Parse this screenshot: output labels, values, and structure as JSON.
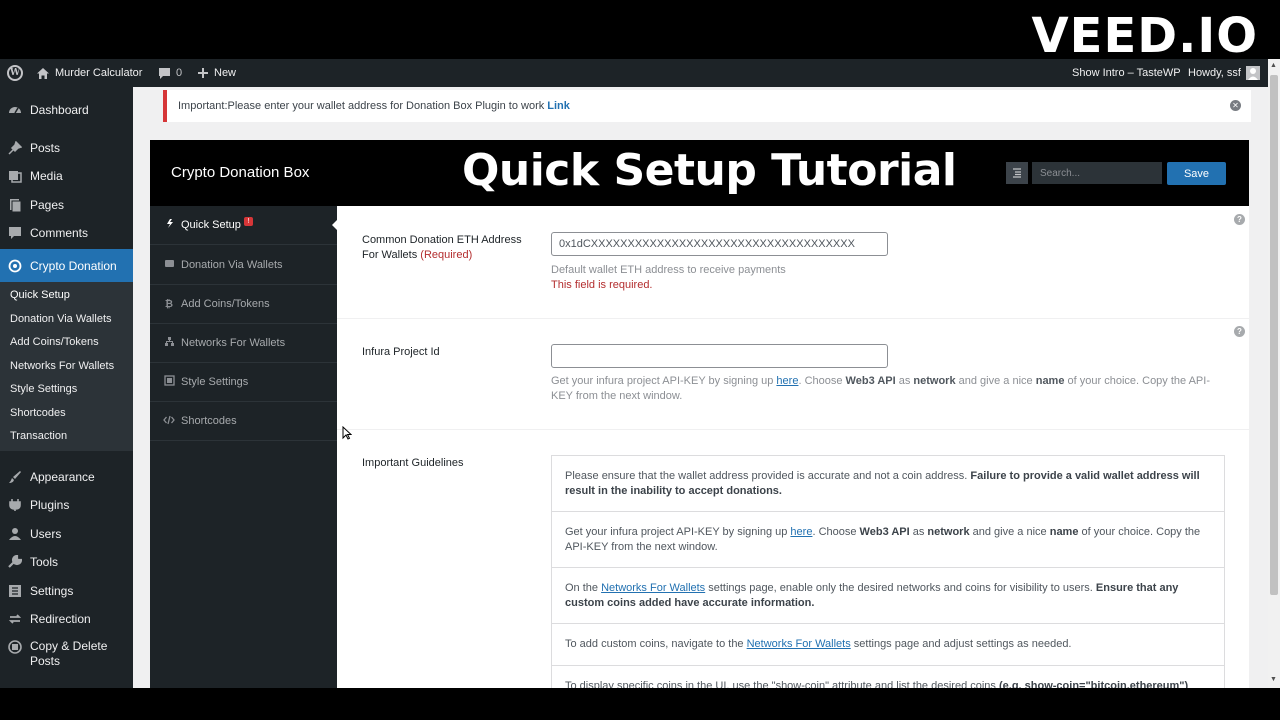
{
  "watermark": "VEED.IO",
  "adminbar": {
    "site_name": "Murder Calculator",
    "comments_count": "0",
    "new_label": "New",
    "show_intro": "Show Intro – TasteWP",
    "howdy": "Howdy, ssf"
  },
  "sidebar": {
    "items": [
      {
        "label": "Dashboard",
        "icon": "dashboard-icon"
      },
      {
        "label": "Posts",
        "icon": "pin-icon"
      },
      {
        "label": "Media",
        "icon": "media-icon"
      },
      {
        "label": "Pages",
        "icon": "pages-icon"
      },
      {
        "label": "Comments",
        "icon": "comment-icon"
      },
      {
        "label": "Crypto Donation",
        "icon": "crypto-icon"
      },
      {
        "label": "Appearance",
        "icon": "brush-icon"
      },
      {
        "label": "Plugins",
        "icon": "plugin-icon"
      },
      {
        "label": "Users",
        "icon": "users-icon"
      },
      {
        "label": "Tools",
        "icon": "wrench-icon"
      },
      {
        "label": "Settings",
        "icon": "settings-icon"
      },
      {
        "label": "Redirection",
        "icon": "redirect-icon"
      },
      {
        "label": "Copy & Delete Posts",
        "icon": "copy-icon"
      }
    ],
    "submenu": [
      "Quick Setup",
      "Donation Via Wallets",
      "Add Coins/Tokens",
      "Networks For Wallets",
      "Style Settings",
      "Shortcodes",
      "Transaction"
    ]
  },
  "notice": {
    "text": "Important:Please enter your wallet address for Donation Box Plugin to work",
    "link": "Link"
  },
  "plugin": {
    "title": "Crypto Donation Box",
    "overlay_title": "Quick Setup Tutorial",
    "search_placeholder": "Search...",
    "save_label": "Save",
    "badge": "!",
    "nav": [
      {
        "label": "Quick Setup",
        "icon": "setup-icon"
      },
      {
        "label": "Donation Via Wallets",
        "icon": "wallet-icon"
      },
      {
        "label": "Add Coins/Tokens",
        "icon": "bitcoin-icon"
      },
      {
        "label": "Networks For Wallets",
        "icon": "network-icon"
      },
      {
        "label": "Style Settings",
        "icon": "style-icon"
      },
      {
        "label": "Shortcodes",
        "icon": "code-icon"
      }
    ]
  },
  "fields": {
    "eth_label": "Common Donation ETH Address For Wallets",
    "eth_required": "(Required)",
    "eth_value": "0x1dCXXXXXXXXXXXXXXXXXXXXXXXXXXXXXXXXXXXX",
    "eth_desc": "Default wallet ETH address to receive payments",
    "eth_error": "This field is required.",
    "infura_label": "Infura Project Id",
    "infura_value": "",
    "infura_desc": {
      "p1": "Get your infura project API-KEY by signing up ",
      "link": "here",
      "p2": ". Choose ",
      "b1": "Web3 API",
      "p3": " as ",
      "b2": "network",
      "p4": " and give a nice ",
      "b3": "name",
      "p5": " of your choice. Copy the API-KEY from the next window."
    },
    "guidelines_label": "Important Guidelines"
  },
  "guidelines": {
    "g1": {
      "p1": "Please ensure that the wallet address provided is accurate and not a coin address. ",
      "b1": "Failure to provide a valid wallet address will result in the inability to accept donations."
    },
    "g2": {
      "p1": "Get your infura project API-KEY by signing up ",
      "link": "here",
      "p2": ". Choose ",
      "b1": "Web3 API",
      "p3": " as ",
      "b2": "network",
      "p4": " and give a nice ",
      "b3": "name",
      "p5": " of your choice. Copy the API-KEY from the next window."
    },
    "g3": {
      "p1": "On the ",
      "link": "Networks For Wallets",
      "p2": " settings page, enable only the desired networks and coins for visibility to users. ",
      "b1": "Ensure that any custom coins added have accurate information."
    },
    "g4": {
      "p1": "To add custom coins, navigate to the ",
      "link": "Networks For Wallets",
      "p2": " settings page and adjust settings as needed."
    },
    "g5": {
      "p1": "To display specific coins in the UI, use the \"show-coin\" attribute and list the desired coins ",
      "b1": "(e.g. show-coin=\"bitcoin,ethereum\")"
    }
  }
}
